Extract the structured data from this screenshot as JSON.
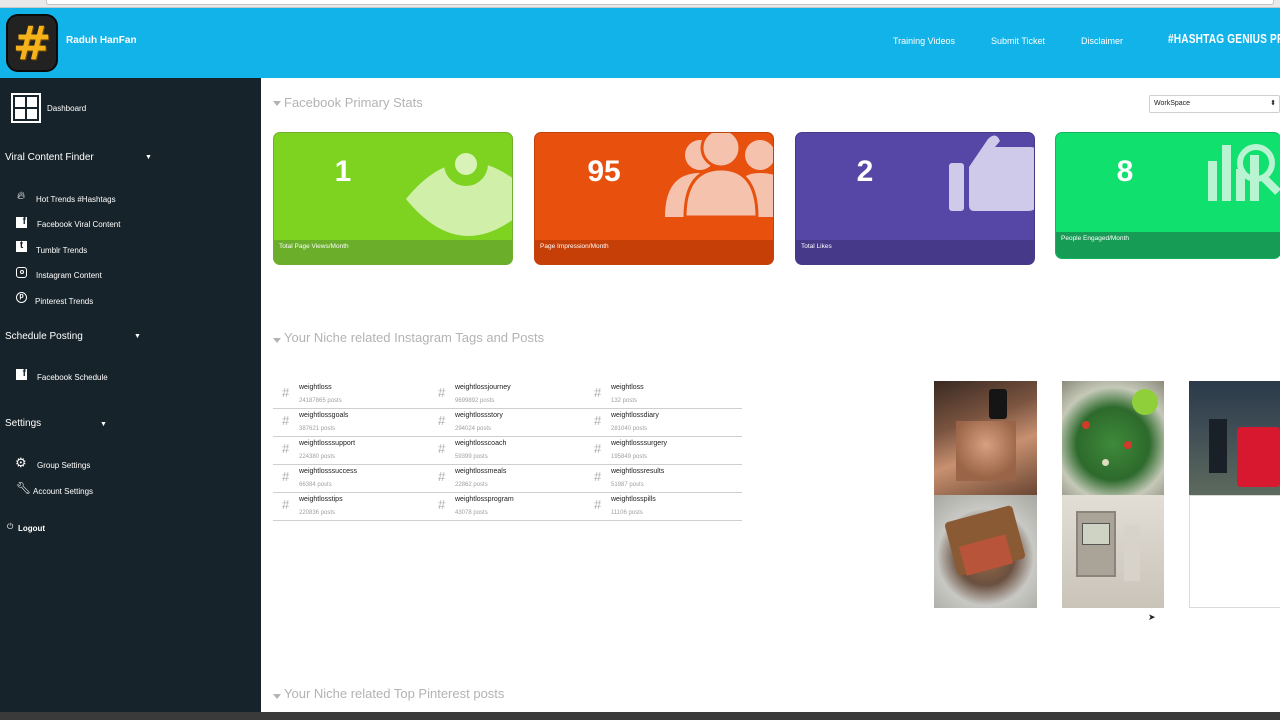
{
  "header": {
    "user_name": "Raduh HanFan",
    "nav": [
      "Training Videos",
      "Submit Ticket",
      "Disclaimer"
    ],
    "brand": "#HASHTAG GENIUS PRO",
    "logo_glyph": "#"
  },
  "sidebar": {
    "dashboard": "Dashboard",
    "viral_finder": "Viral Content Finder",
    "viral_items": [
      "Hot Trends #Hashtags",
      "Facebook Viral Content",
      "Tumblr Trends",
      "Instagram Content",
      "Pinterest Trends"
    ],
    "schedule": "Schedule Posting",
    "schedule_items": [
      "Facebook Schedule"
    ],
    "settings": "Settings",
    "settings_items": [
      "Group Settings",
      "Account Settings"
    ],
    "logout": "Logout"
  },
  "main": {
    "fb_title": "Facebook Primary Stats",
    "workspace": "WorkSpace",
    "cards": [
      {
        "value": "1",
        "label": "Total Page Views/Month",
        "color": "#7ed321",
        "foot": "#6aae2a",
        "icon": "eye-icon"
      },
      {
        "value": "95",
        "label": "Page Impression/Month",
        "color": "#e8500e",
        "foot": "#c53f06",
        "icon": "group-icon"
      },
      {
        "value": "2",
        "label": "Total Likes",
        "color": "#5646a6",
        "foot": "#47398a",
        "icon": "thumbs-up-icon"
      },
      {
        "value": "8",
        "label": "People Engaged/Month",
        "color": "#0fe06e",
        "foot": "#179c55",
        "icon": "chart-search-icon"
      }
    ],
    "ig_title": "Your Niche related Instagram Tags and Posts",
    "tags": [
      [
        {
          "name": "weightloss",
          "posts": "24187865 posts"
        },
        {
          "name": "weightlossjourney",
          "posts": "9699892 posts"
        },
        {
          "name": "weightloss",
          "posts": "132 posts"
        }
      ],
      [
        {
          "name": "weightlossgoals",
          "posts": "387621 posts"
        },
        {
          "name": "weightlossstory",
          "posts": "294024 posts"
        },
        {
          "name": "weightlossdiary",
          "posts": "281040 posts"
        }
      ],
      [
        {
          "name": "weightlosssupport",
          "posts": "224380 posts"
        },
        {
          "name": "weightlosscoach",
          "posts": "59399 posts"
        },
        {
          "name": "weightlosssurgery",
          "posts": "195849 posts"
        }
      ],
      [
        {
          "name": "weightlosssuccess",
          "posts": "66384 posts"
        },
        {
          "name": "weightlossmeals",
          "posts": "22862 posts"
        },
        {
          "name": "weightlossresults",
          "posts": "51987 posts"
        }
      ],
      [
        {
          "name": "weightlosstips",
          "posts": "220836 posts"
        },
        {
          "name": "weightlossprogram",
          "posts": "43078 posts"
        },
        {
          "name": "weightlosspills",
          "posts": "11106 posts"
        }
      ]
    ],
    "pinterest_title": "Your Niche related Top Pinterest posts"
  }
}
